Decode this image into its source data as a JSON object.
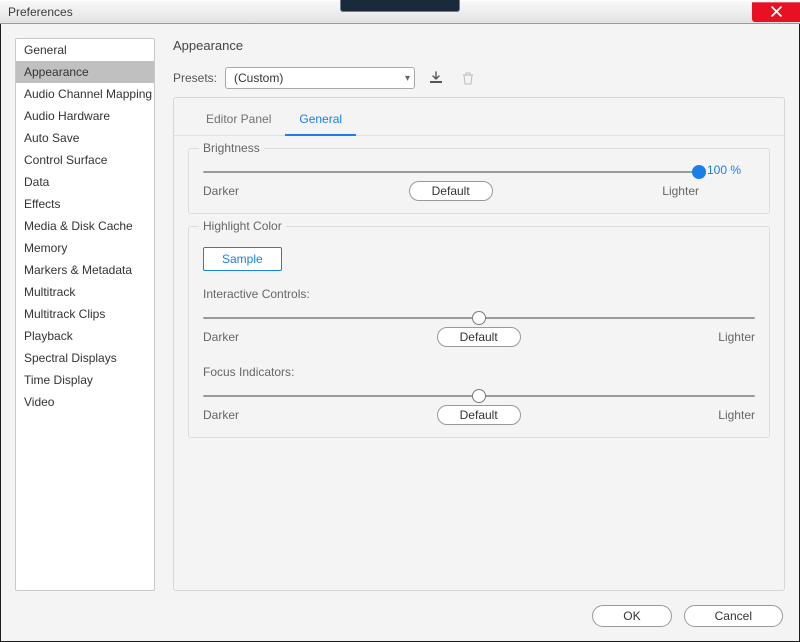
{
  "window": {
    "title": "Preferences"
  },
  "sidebar": {
    "selected_index": 1,
    "items": [
      {
        "label": "General"
      },
      {
        "label": "Appearance"
      },
      {
        "label": "Audio Channel Mapping"
      },
      {
        "label": "Audio Hardware"
      },
      {
        "label": "Auto Save"
      },
      {
        "label": "Control Surface"
      },
      {
        "label": "Data"
      },
      {
        "label": "Effects"
      },
      {
        "label": "Media & Disk Cache"
      },
      {
        "label": "Memory"
      },
      {
        "label": "Markers & Metadata"
      },
      {
        "label": "Multitrack"
      },
      {
        "label": "Multitrack Clips"
      },
      {
        "label": "Playback"
      },
      {
        "label": "Spectral Displays"
      },
      {
        "label": "Time Display"
      },
      {
        "label": "Video"
      }
    ]
  },
  "content": {
    "title": "Appearance",
    "presets": {
      "label": "Presets:",
      "value": "(Custom)"
    },
    "tabs": [
      {
        "label": "Editor Panel",
        "active": false
      },
      {
        "label": "General",
        "active": true
      }
    ],
    "brightness": {
      "title": "Brightness",
      "value": 100,
      "display": "100 %",
      "darker": "Darker",
      "lighter": "Lighter",
      "default_label": "Default"
    },
    "highlight": {
      "title": "Highlight Color",
      "sample_label": "Sample",
      "interactive": {
        "title": "Interactive Controls:",
        "position_pct": 50,
        "darker": "Darker",
        "lighter": "Lighter",
        "default_label": "Default"
      },
      "focus": {
        "title": "Focus Indicators:",
        "position_pct": 50,
        "darker": "Darker",
        "lighter": "Lighter",
        "default_label": "Default"
      }
    }
  },
  "footer": {
    "ok": "OK",
    "cancel": "Cancel"
  }
}
